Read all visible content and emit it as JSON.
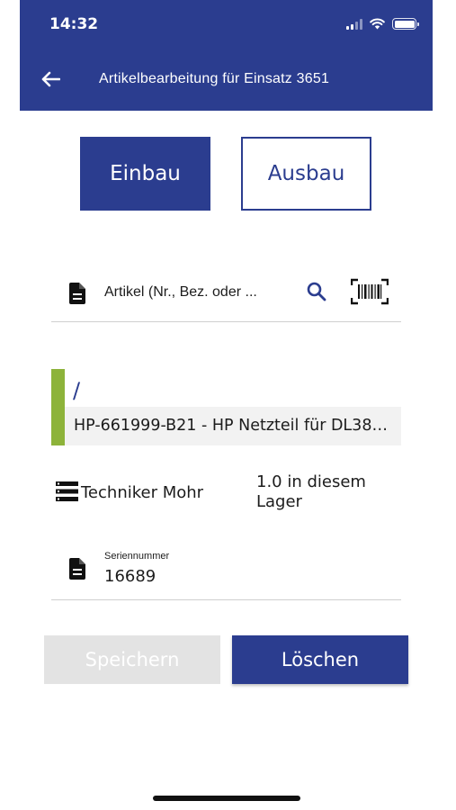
{
  "status_bar": {
    "time": "14:32"
  },
  "header": {
    "title": "Artikelbearbeitung für Einsatz 3651"
  },
  "mode_toggle": {
    "install_label": "Einbau",
    "remove_label": "Ausbau",
    "selected": "Einbau"
  },
  "search": {
    "placeholder_text": "Artikel (Nr., Bez. oder ..."
  },
  "article": {
    "path": "/",
    "name": "HP-661999-B21 - HP Netzteil für DL38…"
  },
  "technician": {
    "name": "Techniker Mohr",
    "stock": "1.0 in diesem Lager"
  },
  "serial": {
    "label": "Seriennummer",
    "value": "16689"
  },
  "actions": {
    "save_label": "Speichern",
    "delete_label": "Löschen"
  },
  "colors": {
    "primary": "#2b3d8f",
    "accent_green": "#8db33a",
    "disabled": "#e3e3e3"
  }
}
